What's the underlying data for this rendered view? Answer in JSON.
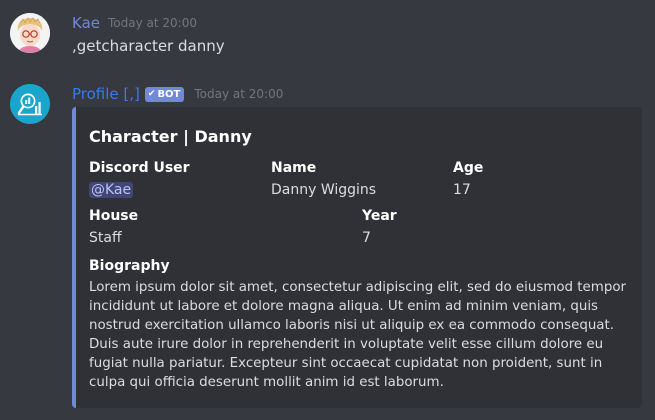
{
  "messages": [
    {
      "author": "Kae",
      "author_color": "#7289da",
      "timestamp": "Today at 20:00",
      "content": ",getcharacter danny",
      "avatar_icon": "cartoon-portrait-avatar"
    },
    {
      "author": "Profile [,]",
      "author_color": "#3b78f0",
      "bot_tag": "BOT",
      "timestamp": "Today at 20:00",
      "avatar_icon": "magnifier-chart-avatar",
      "embed": {
        "accent_color": "#7289da",
        "title": "Character | Danny",
        "fields": {
          "discord_user": {
            "name": "Discord User",
            "value": "@Kae"
          },
          "char_name": {
            "name": "Name",
            "value": "Danny Wiggins"
          },
          "age": {
            "name": "Age",
            "value": "17"
          },
          "house": {
            "name": "House",
            "value": "Staff"
          },
          "year": {
            "name": "Year",
            "value": "7"
          },
          "biography": {
            "name": "Biography",
            "value": "Lorem ipsum dolor sit amet, consectetur adipiscing elit, sed do eiusmod tempor incididunt ut labore et dolore magna aliqua. Ut enim ad minim veniam, quis nostrud exercitation ullamco laboris nisi ut aliquip ex ea commodo consequat. Duis aute irure dolor in reprehenderit in voluptate velit esse cillum dolore eu fugiat nulla pariatur. Excepteur sint occaecat cupidatat non proident, sunt in culpa qui officia deserunt mollit anim id est laborum."
          }
        }
      }
    }
  ]
}
